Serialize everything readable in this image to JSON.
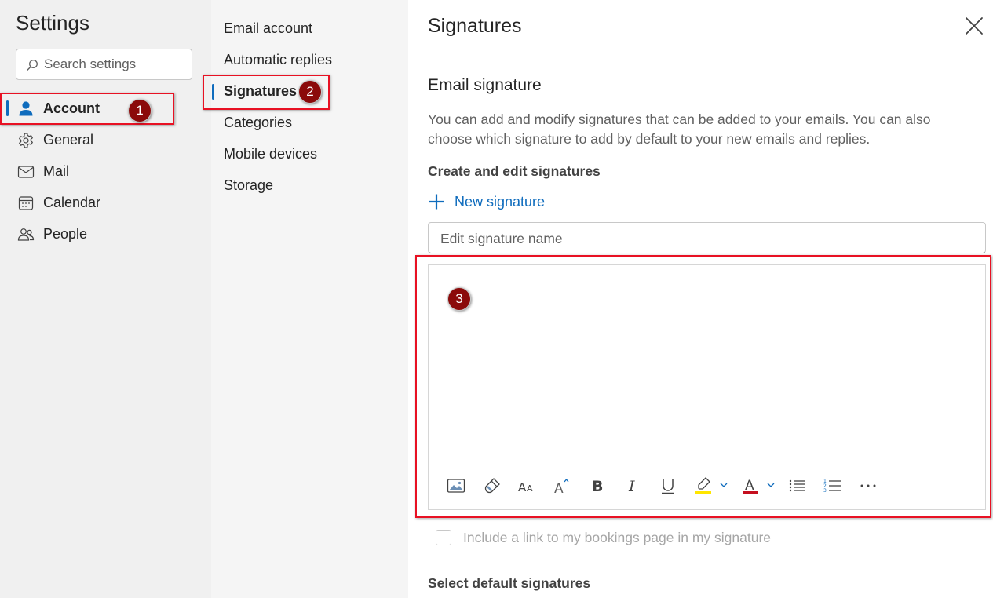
{
  "left_pane": {
    "title": "Settings",
    "search_placeholder": "Search settings",
    "nav_items": [
      {
        "label": "Account",
        "icon": "person-icon",
        "active": true
      },
      {
        "label": "General",
        "icon": "gear-icon",
        "active": false
      },
      {
        "label": "Mail",
        "icon": "mail-icon",
        "active": false
      },
      {
        "label": "Calendar",
        "icon": "calendar-icon",
        "active": false
      },
      {
        "label": "People",
        "icon": "people-icon",
        "active": false
      }
    ]
  },
  "middle_pane": {
    "items": [
      {
        "label": "Email account",
        "active": false
      },
      {
        "label": "Automatic replies",
        "active": false
      },
      {
        "label": "Signatures",
        "active": true
      },
      {
        "label": "Categories",
        "active": false
      },
      {
        "label": "Mobile devices",
        "active": false
      },
      {
        "label": "Storage",
        "active": false
      }
    ]
  },
  "right_pane": {
    "title": "Signatures",
    "section_title": "Email signature",
    "description": "You can add and modify signatures that can be added to your emails. You can also choose which signature to add by default to your new emails and replies.",
    "create_heading": "Create and edit signatures",
    "new_signature_label": "New signature",
    "signature_name_placeholder": "Edit signature name",
    "editor_toolbar": [
      "insert-picture-icon",
      "format-painter-icon",
      "font-size-icon",
      "grow-font-icon",
      "bold-icon",
      "italic-icon",
      "underline-icon",
      "highlight-icon",
      "font-color-icon",
      "bullets-icon",
      "numbering-icon",
      "more-options-icon"
    ],
    "bookings_checkbox_label": "Include a link to my bookings page in my signature",
    "bookings_checked": false,
    "select_default_heading": "Select default signatures"
  },
  "annotations": {
    "badge_1": "1",
    "badge_2": "2",
    "badge_3": "3"
  },
  "colors": {
    "accent": "#0f6cbd",
    "annotation_red": "#e81123",
    "badge_fill": "#8b0a0a",
    "highlight_yellow": "#ffe600",
    "font_color_red": "#c50f1f"
  }
}
